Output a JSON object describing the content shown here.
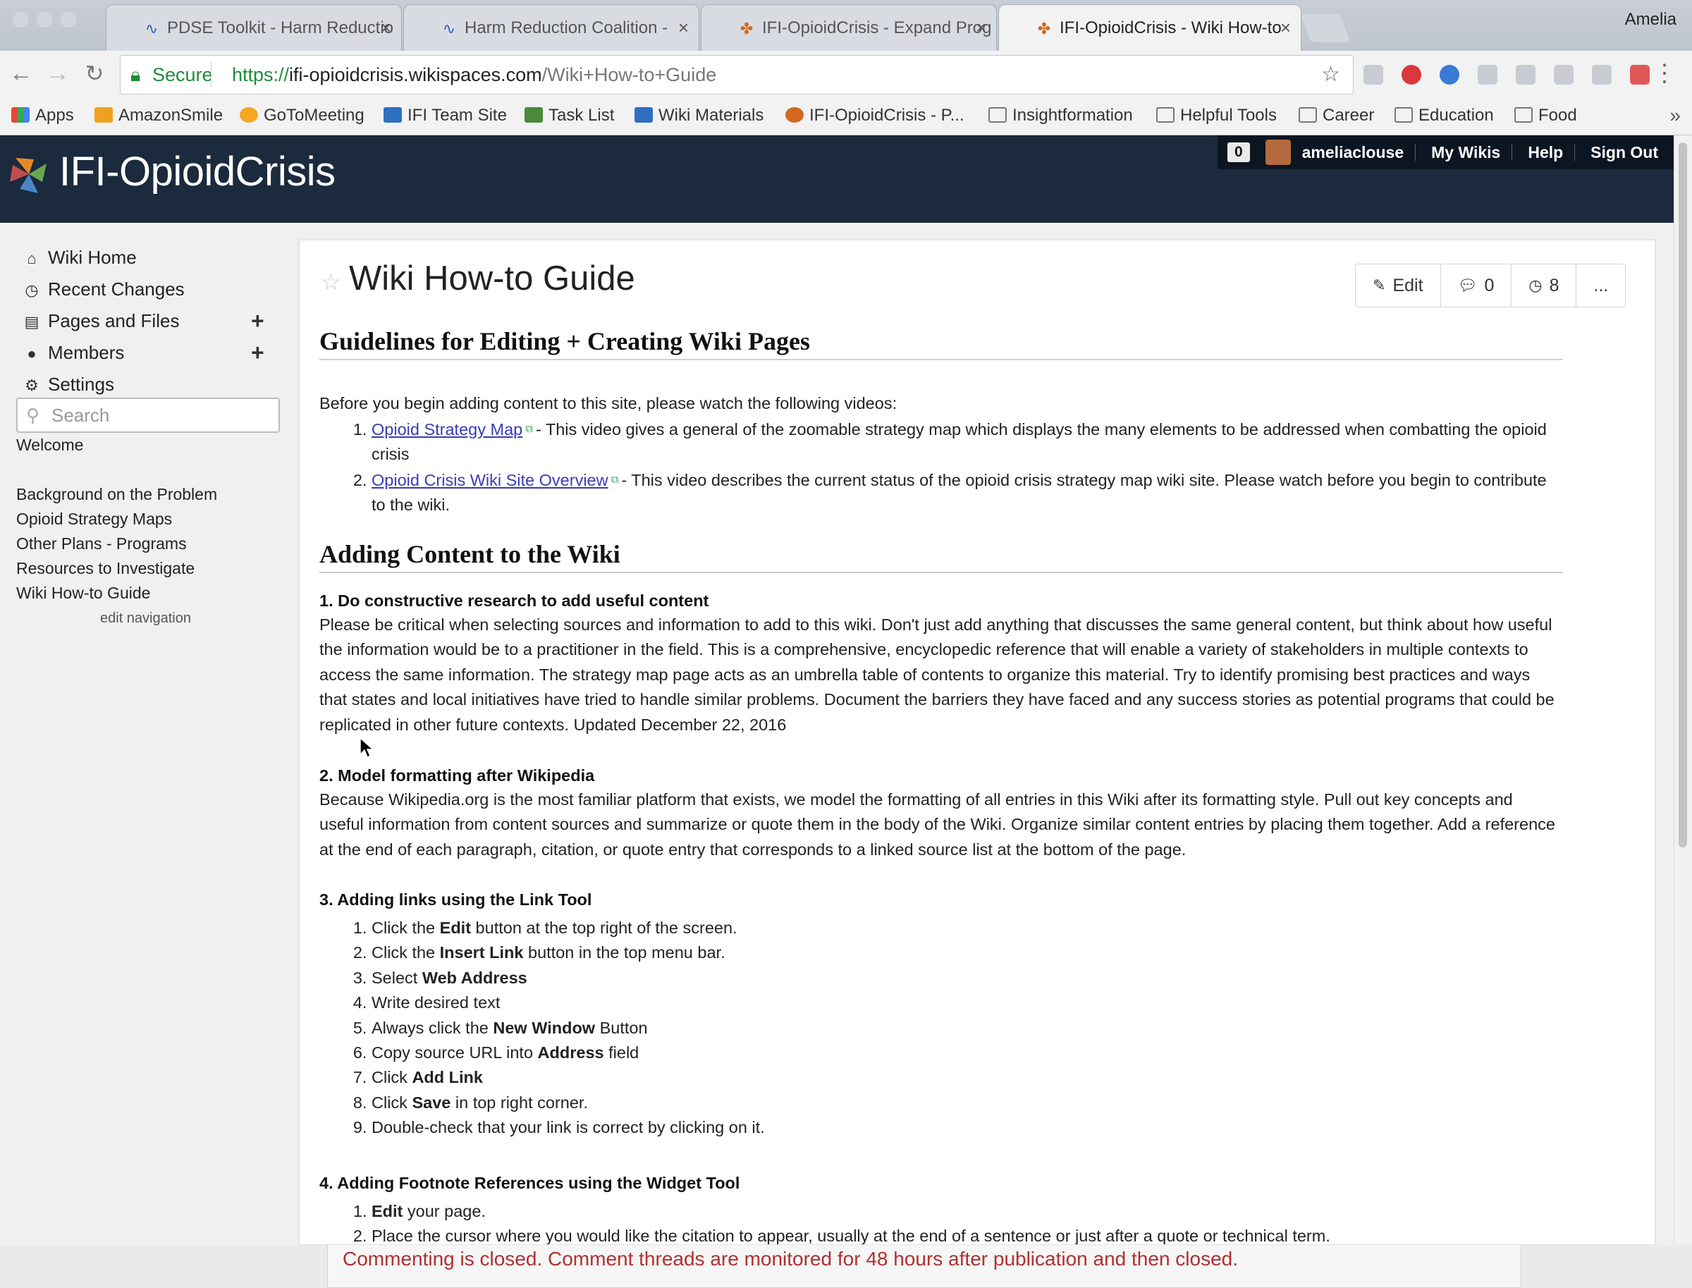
{
  "browser": {
    "profile_name": "Amelia",
    "tabs": [
      {
        "title": "PDSE Toolkit - Harm Reductio",
        "icon": "wave-icon",
        "active": false
      },
      {
        "title": "Harm Reduction Coalition -",
        "icon": "wave-icon",
        "active": false
      },
      {
        "title": "IFI-OpioidCrisis - Expand Prog",
        "icon": "pinwheel-icon",
        "active": false
      },
      {
        "title": "IFI-OpioidCrisis - Wiki How-to",
        "icon": "pinwheel-icon",
        "active": true
      }
    ],
    "secure_label": "Secure",
    "url_scheme": "https://",
    "url_host": "ifi-opioidcrisis.wikispaces.com",
    "url_path": "/Wiki+How-to+Guide",
    "bookmarks": [
      {
        "label": "Apps",
        "icon": "apps-grid-icon"
      },
      {
        "label": "AmazonSmile",
        "icon": "amazon-icon"
      },
      {
        "label": "GoToMeeting",
        "icon": "gotomeeting-icon"
      },
      {
        "label": "IFI Team Site",
        "icon": "sharepoint-icon"
      },
      {
        "label": "Task List",
        "icon": "clipboard-icon"
      },
      {
        "label": "Wiki Materials",
        "icon": "sharepoint-icon"
      },
      {
        "label": "IFI-OpioidCrisis - P...",
        "icon": "pinwheel-icon"
      },
      {
        "label": "Insightformation",
        "icon": "folder-icon"
      },
      {
        "label": "Helpful Tools",
        "icon": "folder-icon"
      },
      {
        "label": "Career",
        "icon": "folder-icon"
      },
      {
        "label": "Education",
        "icon": "folder-icon"
      },
      {
        "label": "Food",
        "icon": "folder-icon"
      }
    ],
    "bookmarks_more": "»"
  },
  "site": {
    "title": "IFI-OpioidCrisis",
    "notif_count": "0",
    "username": "ameliaclouse",
    "my_wikis": "My Wikis",
    "help": "Help",
    "sign_out": "Sign Out",
    "header_color": "#1b2a3d"
  },
  "sidebar": {
    "items": [
      {
        "label": "Wiki Home",
        "icon": "home-icon"
      },
      {
        "label": "Recent Changes",
        "icon": "clock-icon"
      },
      {
        "label": "Pages and Files",
        "icon": "page-icon"
      },
      {
        "label": "Members",
        "icon": "person-icon"
      },
      {
        "label": "Settings",
        "icon": "gear-icon"
      }
    ],
    "search_placeholder": "Search",
    "nav_links": [
      "Welcome",
      "Background on the Problem",
      "Opioid Strategy Maps",
      "Other Plans - Programs",
      "Resources to Investigate",
      "Wiki How-to Guide"
    ],
    "edit_navigation": "edit navigation"
  },
  "page": {
    "title": "Wiki How-to Guide",
    "actions": {
      "edit": "Edit",
      "comments": "0",
      "history": "8",
      "more": "..."
    },
    "sections": {
      "guidelines_heading": "Guidelines for Editing + Creating Wiki Pages",
      "intro": "Before you begin adding content to this site, please watch the following videos:",
      "videos": [
        {
          "link": "Opioid Strategy Map",
          "text": "- This video gives a general of the zoomable strategy map which displays the many elements to be addressed when combatting the opioid crisis"
        },
        {
          "link": "Opioid Crisis Wiki Site Overview",
          "text": "- This video describes the current status of the opioid crisis strategy map wiki site. Please watch before you begin to contribute to the wiki."
        }
      ],
      "adding_heading": "Adding Content to the Wiki",
      "s1_title": "1. Do constructive research to add useful content",
      "s1_body": "Please be critical when selecting sources and information to add to this wiki. Don't just add anything that discusses the same general content, but think about how useful the information would be to a practitioner in the field. This is a comprehensive, encyclopedic reference that will enable a variety of stakeholders in multiple contexts to access the same information. The strategy map page acts as an umbrella table of contents to organize this material. Try to identify promising best practices and ways that states and local initiatives have tried to handle similar problems. Document the barriers they have faced and any success stories as potential programs that could be replicated in other future contexts. Updated December 22, 2016",
      "s2_title": "2. Model formatting after Wikipedia",
      "s2_body": "Because Wikipedia.org is the most familiar platform that exists, we model the formatting of all entries in this Wiki after its formatting style. Pull out key concepts and useful information from content sources and summarize or quote them in the body of the Wiki. Organize similar content entries by placing them together. Add a reference at the end of each paragraph, citation, or quote entry that corresponds to a linked source list at the bottom of the page.",
      "s3_title": "3. Adding links using the Link Tool",
      "s3_steps": [
        {
          "pre": "Click the ",
          "bold": "Edit",
          "post": " button at the top right of the screen."
        },
        {
          "pre": "Click the ",
          "bold": "Insert Link",
          "post": " button in the top menu bar."
        },
        {
          "pre": "Select ",
          "bold": "Web Address",
          "post": ""
        },
        {
          "pre": "Write desired text",
          "bold": "",
          "post": ""
        },
        {
          "pre": "Always click the ",
          "bold": "New Window",
          "post": " Button"
        },
        {
          "pre": "Copy source URL into ",
          "bold": "Address",
          "post": " field"
        },
        {
          "pre": "Click ",
          "bold": "Add Link",
          "post": ""
        },
        {
          "pre": "Click ",
          "bold": "Save",
          "post": " in top right corner."
        },
        {
          "pre": "Double-check that your link is correct by clicking on it.",
          "bold": "",
          "post": ""
        }
      ],
      "s4_title": "4. Adding Footnote References using the Widget Tool",
      "s4_steps": [
        {
          "pre": "",
          "bold": "Edit",
          "post": " your page."
        },
        {
          "pre": "Place the cursor where you would like the citation to appear, usually at the end of a sentence or just after a quote or technical term.",
          "bold": "",
          "post": ""
        }
      ]
    }
  },
  "comment_notice": "Commenting is closed. Comment threads are monitored for 48 hours after publication and then closed.",
  "colors": {
    "link": "#3b3bb7",
    "secure_green": "#1e8c3a",
    "notice_red": "#b03030"
  }
}
